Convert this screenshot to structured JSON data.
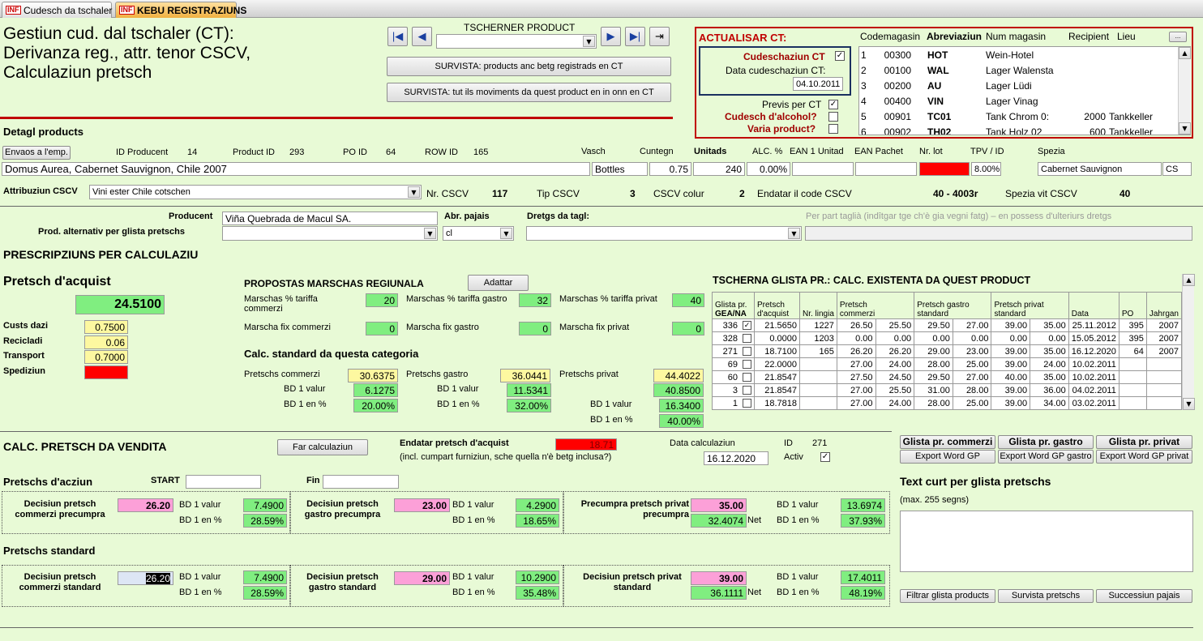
{
  "tabs": [
    {
      "label": "Cudesch da tschaler"
    },
    {
      "label": "KEBU REGISTRAZIUNS"
    }
  ],
  "logo": "INF",
  "title": {
    "l1": "Gestiun cud. dal tschaler (CT):",
    "l2": "Derivanza reg., attr. tenor CSCV,",
    "l3": "Calculaziun pretsch"
  },
  "nav": {
    "label": "TSCHERNER PRODUCT",
    "btn1": "SURVISTA: products anc betg registrads en CT",
    "btn2": "SURVISTA: tut ils moviments da quest product en in onn en CT"
  },
  "ct": {
    "title": "ACTUALISAR CT:",
    "cudeschaziun": "Cudeschaziun CT",
    "data_label": "Data cudeschaziun CT:",
    "data": "04.10.2011",
    "previs": "Previs per CT",
    "alcohol": "Cudesch d'alcohol?",
    "varia": "Varia product?",
    "cols": {
      "code": "Codemagasin",
      "abr": "Abreviaziun",
      "num": "Num magasin",
      "rec": "Recipient",
      "lieu": "Lieu"
    },
    "more": "...",
    "rows": [
      {
        "n": "1",
        "code": "00300",
        "abr": "HOT",
        "num": "Wein-Hotel",
        "rec": "",
        "lieu": ""
      },
      {
        "n": "2",
        "code": "00100",
        "abr": "WAL",
        "num": "Lager Walensta",
        "rec": "",
        "lieu": ""
      },
      {
        "n": "3",
        "code": "00200",
        "abr": "AU",
        "num": "Lager Lüdi",
        "rec": "",
        "lieu": ""
      },
      {
        "n": "4",
        "code": "00400",
        "abr": "VIN",
        "num": "Lager Vinag",
        "rec": "",
        "lieu": ""
      },
      {
        "n": "5",
        "code": "00901",
        "abr": "TC01",
        "num": "Tank Chrom 0:",
        "rec": "2000",
        "lieu": "Tankkeller"
      },
      {
        "n": "6",
        "code": "00902",
        "abr": "TH02",
        "num": "Tank Holz 02",
        "rec": "600",
        "lieu": "Tankkeller"
      }
    ]
  },
  "detail": {
    "title": "Detagl products",
    "envoi": "Envaos a l'emp.",
    "idp_l": "ID Producent",
    "idp": "14",
    "pid_l": "Product ID",
    "pid": "293",
    "po_l": "PO ID",
    "po": "64",
    "row_l": "ROW ID",
    "row": "165",
    "vasch_l": "Vasch",
    "cuntegn_l": "Cuntegn",
    "unitads_l": "Unitads",
    "alc_l": "ALC. %",
    "ean1_l": "EAN 1 Unitad",
    "eanp_l": "EAN Pachet",
    "lot_l": "Nr. lot",
    "tpv_l": "TPV / ID",
    "spezia_l": "Spezia",
    "name": "Domus Aurea, Cabernet Sauvignon, Chile 2007",
    "vasch": "Bottles",
    "cuntegn": "0.75",
    "unitads": "240",
    "alc": "0.00%",
    "tpv": "8.00%",
    "spezia": "Cabernet Sauvignon",
    "spezia2": "CS"
  },
  "attr": {
    "label": "Attribuziun CSCV",
    "value": "Vini ester Chile cotschen",
    "nr_l": "Nr. CSCV",
    "nr": "117",
    "tip_l": "Tip CSCV",
    "tip": "3",
    "col_l": "CSCV colur",
    "col": "2",
    "end_l": "Endatar il code CSCV",
    "end": "40 - 4003r",
    "vit_l": "Spezia vit CSCV",
    "vit": "40"
  },
  "prod": {
    "label": "Producent",
    "value": "Viña Quebrada de Macul SA.",
    "abr_l": "Abr. pajais",
    "abr": "cl",
    "dretgs_l": "Dretgs da tagl:",
    "hint": "Per part taglià (indîtgar tge ch'è gia vegni fatg) – en possess d'ulteriurs dretgs",
    "alt_l": "Prod. alternativ per glista pretschs"
  },
  "presc": {
    "title": "PRESCRIPZIUNS PER CALCULAZIU"
  },
  "acquist": {
    "title": "Pretsch d'acquist",
    "value": "24.5100",
    "dazi_l": "Custs dazi",
    "dazi": "0.7500",
    "recic_l": "Recicladi",
    "recic": "0.06",
    "trans_l": "Transport",
    "trans": "0.7000",
    "sped_l": "Spediziun"
  },
  "marsch": {
    "title": "PROPOSTAS MARSCHAS REGIUNALA",
    "adattar": "Adattar",
    "t_comm": "Marschas % tariffa commerzi",
    "v_comm": "20",
    "t_gastro": "Marschas % tariffa gastro",
    "v_gastro": "32",
    "t_priv": "Marschas % tariffa privat",
    "v_priv": "40",
    "f_comm": "Marscha fix commerzi",
    "fv_comm": "0",
    "f_gastro": "Marscha fix gastro",
    "fv_gastro": "0",
    "f_priv": "Marscha fix privat",
    "fv_priv": "0"
  },
  "calcstd": {
    "title": "Calc. standard da questa categoria",
    "pc_l": "Pretschs commerzi",
    "pc": "30.6375",
    "pg_l": "Pretschs gastro",
    "pg": "36.0441",
    "pp_l": "Pretschs privat",
    "pp": "44.4022",
    "bdv": "BD 1 valur",
    "bdp": "BD 1 en %",
    "c_v": "6.1275",
    "c_p": "20.00%",
    "g_v": "11.5341",
    "g_p": "32.00%",
    "p_x": "40.8500",
    "p_v": "16.3400",
    "p_p": "40.00%"
  },
  "glista": {
    "title": "TSCHERNA GLISTA PR.: CALC. EXISTENTA DA QUEST PRODUCT",
    "h": {
      "g1": "Glista pr.",
      "g2": "GEA/NA",
      "pa1": "Pretsch",
      "pa2": "d'acquist",
      "nl": "Nr. lingia",
      "pc1": "Pretsch",
      "pc2": "commerzi",
      "pg1": "Pretsch gastro",
      "pg2": "standard",
      "pp1": "Pretsch privat",
      "pp2": "standard",
      "d": "Data",
      "po": "PO",
      "j": "Jahrgan"
    },
    "rows": [
      {
        "g": "336",
        "chk": "✓",
        "pa": "21.5650",
        "nl": "1227",
        "c1": "26.50",
        "c2": "25.50",
        "g1": "29.50",
        "g2": "27.00",
        "p1": "39.00",
        "p2": "35.00",
        "d": "25.11.2012",
        "po": "395",
        "j": "2007"
      },
      {
        "g": "328",
        "chk": "",
        "pa": "0.0000",
        "nl": "1203",
        "c1": "0.00",
        "c2": "0.00",
        "g1": "0.00",
        "g2": "0.00",
        "p1": "0.00",
        "p2": "0.00",
        "d": "15.05.2012",
        "po": "395",
        "j": "2007"
      },
      {
        "g": "271",
        "chk": "",
        "pa": "18.7100",
        "nl": "165",
        "c1": "26.20",
        "c2": "26.20",
        "g1": "29.00",
        "g2": "23.00",
        "p1": "39.00",
        "p2": "35.00",
        "d": "16.12.2020",
        "po": "64",
        "j": "2007"
      },
      {
        "g": "69",
        "chk": "",
        "pa": "22.0000",
        "nl": "",
        "c1": "27.00",
        "c2": "24.00",
        "g1": "28.00",
        "g2": "25.00",
        "p1": "39.00",
        "p2": "24.00",
        "d": "10.02.2011",
        "po": "",
        "j": ""
      },
      {
        "g": "60",
        "chk": "",
        "pa": "21.8547",
        "nl": "",
        "c1": "27.50",
        "c2": "24.50",
        "g1": "29.50",
        "g2": "27.00",
        "p1": "40.00",
        "p2": "35.00",
        "d": "10.02.2011",
        "po": "",
        "j": ""
      },
      {
        "g": "3",
        "chk": "",
        "pa": "21.8547",
        "nl": "",
        "c1": "27.00",
        "c2": "25.50",
        "g1": "31.00",
        "g2": "28.00",
        "p1": "39.00",
        "p2": "36.00",
        "d": "04.02.2011",
        "po": "",
        "j": ""
      },
      {
        "g": "1",
        "chk": "",
        "pa": "18.7818",
        "nl": "",
        "c1": "27.00",
        "c2": "24.00",
        "g1": "28.00",
        "g2": "25.00",
        "p1": "39.00",
        "p2": "34.00",
        "d": "03.02.2011",
        "po": "",
        "j": ""
      }
    ]
  },
  "vend": {
    "title": "CALC. PRETSCH DA VENDITA",
    "far": "Far calculaziun",
    "end_l": "Endatar pretsch d'acquist",
    "end": "18.71",
    "incl": "(incl. cumpart furniziun, sche quella n'è betg inclusa?)",
    "data_l": "Data calculaziun",
    "data": "16.12.2020",
    "id_l": "ID",
    "id": "271",
    "activ_l": "Activ"
  },
  "gl": {
    "comm": "Glista pr. commerzi",
    "gastro": "Glista pr. gastro",
    "priv": "Glista pr. privat",
    "w1": "Export Word GP",
    "w2": "Export Word GP gastro",
    "w3": "Export Word GP privat"
  },
  "aczi": {
    "title": "Pretschs d'acziun",
    "start": "START",
    "fin": "Fin",
    "c_l": "Decisiun pretsch commerzi precumpra",
    "c": "26.20",
    "c_v": "7.4900",
    "c_p": "28.59%",
    "g_l": "Decisiun pretsch gastro precumpra",
    "g": "23.00",
    "g_v": "4.2900",
    "g_p": "18.65%",
    "p_l": "Precumpra pretsch privat precumpra",
    "p": "35.00",
    "p_n": "32.4074",
    "p_v": "13.6974",
    "p_p": "37.93%",
    "net": "Net"
  },
  "std": {
    "title": "Pretschs standard",
    "c_l": "Decisiun pretsch commerzi standard",
    "c": "26.20",
    "c_v": "7.4900",
    "c_p": "28.59%",
    "g_l": "Decisiun pretsch gastro standard",
    "g": "29.00",
    "g_v": "10.2900",
    "g_p": "35.48%",
    "p_l": "Decisiun pretsch privat standard",
    "p": "39.00",
    "p_n": "36.1111",
    "p_v": "17.4011",
    "p_p": "48.19%",
    "net": "Net"
  },
  "bd": {
    "v": "BD 1 valur",
    "p": "BD 1 en %"
  },
  "text": {
    "title": "Text curt per glista pretschs",
    "sub": "(max. 255 segns)"
  },
  "bottom": {
    "b1": "Filtrar glista products",
    "b2": "Survista pretschs",
    "b3": "Successiun pajais"
  }
}
